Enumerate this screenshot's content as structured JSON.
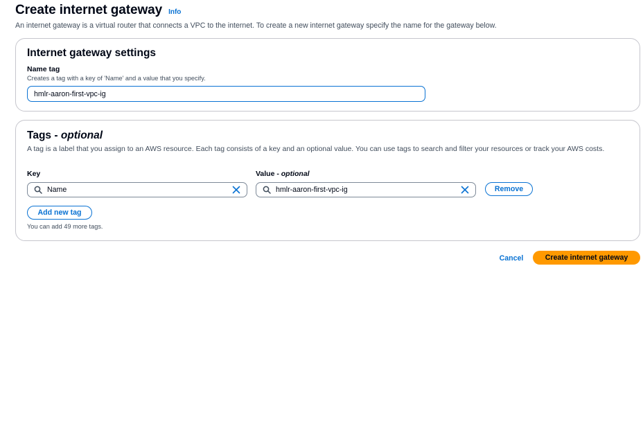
{
  "header": {
    "title": "Create internet gateway",
    "info_link": "Info",
    "description": "An internet gateway is a virtual router that connects a VPC to the internet. To create a new internet gateway specify the name for the gateway below."
  },
  "settings_panel": {
    "title": "Internet gateway settings",
    "name_tag": {
      "label": "Name tag",
      "description": "Creates a tag with a key of 'Name' and a value that you specify.",
      "value": "hmlr-aaron-first-vpc-ig"
    }
  },
  "tags_panel": {
    "title": "Tags - ",
    "title_optional": "optional",
    "description": "A tag is a label that you assign to an AWS resource. Each tag consists of a key and an optional value. You can use tags to search and filter your resources or track your AWS costs.",
    "key_label": "Key",
    "value_label": "Value - ",
    "value_label_optional": "optional",
    "tags": [
      {
        "key": "Name",
        "value": "hmlr-aaron-first-vpc-ig",
        "remove_label": "Remove"
      }
    ],
    "add_tag_label": "Add new tag",
    "limit_hint": "You can add 49 more tags."
  },
  "footer": {
    "cancel_label": "Cancel",
    "submit_label": "Create internet gateway"
  },
  "icons": {
    "search": "search-icon",
    "clear": "close-icon"
  },
  "colors": {
    "link": "#0972d3",
    "primary_button": "#ff9900",
    "text": "#000716",
    "secondary_text": "#414d5c",
    "panel_border": "#c6c6cd"
  }
}
